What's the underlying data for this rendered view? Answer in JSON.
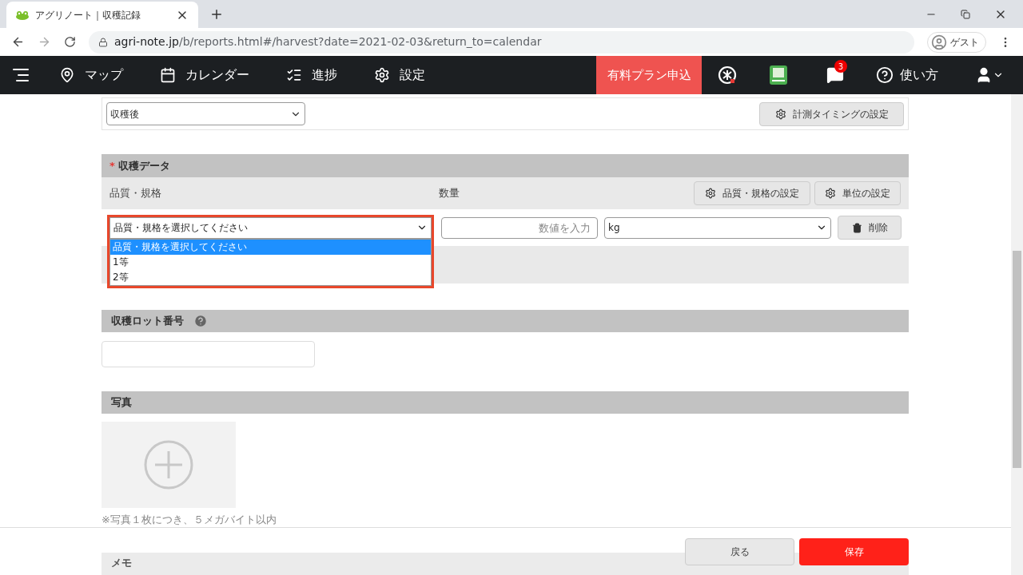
{
  "browser": {
    "tab_title": "アグリノート｜収穫記録",
    "url_domain": "agri-note.jp",
    "url_path": "/b/reports.html#/harvest?date=2021-02-03&return_to=calendar",
    "profile": "ゲスト"
  },
  "navbar": {
    "items": [
      {
        "kind": "map",
        "label": "マップ"
      },
      {
        "kind": "calendar",
        "label": "カレンダー"
      },
      {
        "kind": "progress",
        "label": "進捗"
      },
      {
        "kind": "settings",
        "label": "設定"
      }
    ],
    "plan_button": "有料プラン申込",
    "notification_count": "3",
    "help": "使い方"
  },
  "timing": {
    "select_value": "収穫後",
    "settings_button": "計測タイミングの設定"
  },
  "harvest_data": {
    "required_mark": "*",
    "title": "収穫データ",
    "col_quality": "品質・規格",
    "col_quantity": "数量",
    "quality_settings_button": "品質・規格の設定",
    "unit_settings_button": "単位の設定",
    "row": {
      "quality_value": "品質・規格を選択してください",
      "quantity_placeholder": "数値を入力",
      "unit_value": "kg",
      "delete_button": "削除"
    },
    "dropdown": {
      "expanded": true,
      "options": [
        {
          "label": "品質・規格を選択してください",
          "selected": true
        },
        {
          "label": "1等",
          "selected": false
        },
        {
          "label": "2等",
          "selected": false
        }
      ]
    }
  },
  "lot": {
    "title": "収穫ロット番号"
  },
  "photo": {
    "title": "写真",
    "note": "※写真１枚につき、５メガバイト以内"
  },
  "memo": {
    "title": "メモ"
  },
  "footer": {
    "back_button": "戻る",
    "save_button": "保存"
  }
}
